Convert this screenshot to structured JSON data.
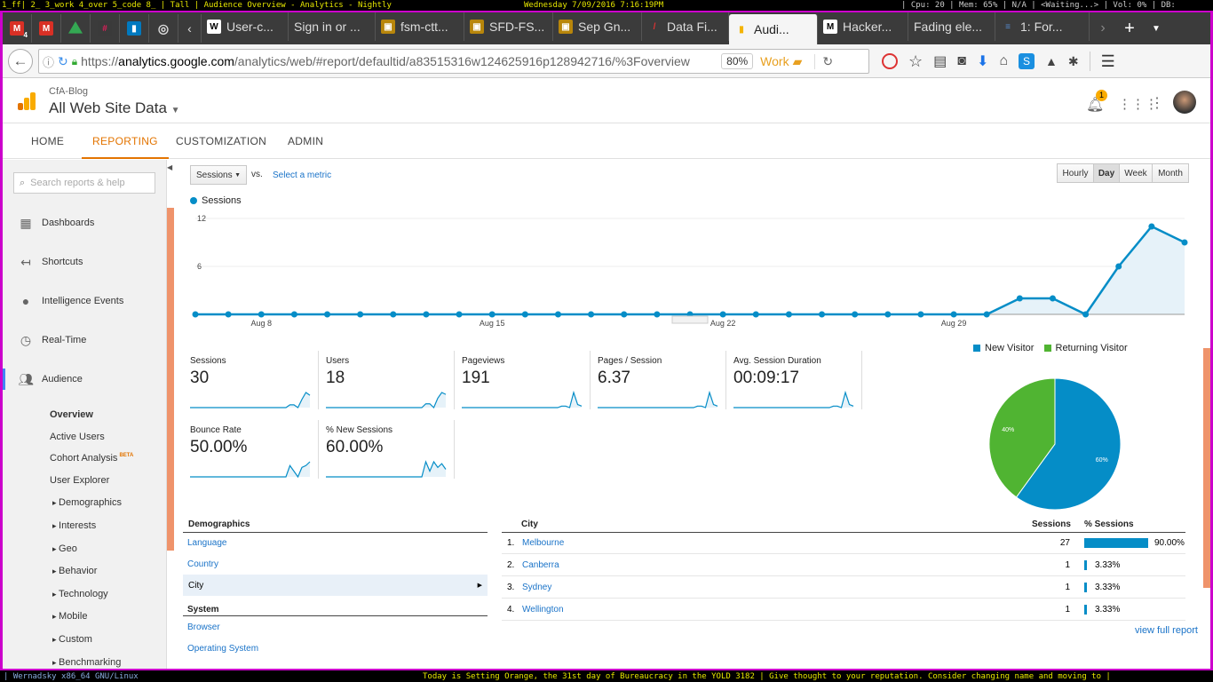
{
  "topbar": {
    "left": "1_ff| 2_ 3_work 4_over 5_code 8_ | Tall | Audience Overview - Analytics - Nightly",
    "center": "Wednesday  7/09/2016  7:16:19PM",
    "right": "| Cpu: 20 | Mem: 65% | N/A | <Waiting...> | Vol: 0% | DB:"
  },
  "bottombar": {
    "left": "| Wernadsky x86_64 GNU/Linux",
    "right": "Today is Setting Orange, the 31st day of Bureaucracy in the YOLD 3182  | Give thought to your reputation.  Consider changing name and moving to |"
  },
  "browser": {
    "tabs": [
      {
        "label": "User-c...",
        "icon": "W",
        "color": "#fff"
      },
      {
        "label": "Sign in or ...",
        "icon": "",
        "color": ""
      },
      {
        "label": "fsm-ctt...",
        "icon": "gh",
        "color": "#b8860b"
      },
      {
        "label": "SFD-FS...",
        "icon": "gh",
        "color": "#b8860b"
      },
      {
        "label": "Sep Gn...",
        "icon": "gh",
        "color": "#b8860b"
      },
      {
        "label": "Data Fi...",
        "icon": "pen",
        "color": "#d33"
      },
      {
        "label": "Audi...",
        "icon": "ga",
        "color": "#f4b400"
      },
      {
        "label": "Hacker...",
        "icon": "M",
        "color": "#fff"
      },
      {
        "label": "Fading ele...",
        "icon": "",
        "color": ""
      },
      {
        "label": "1: For...",
        "icon": "st",
        "color": "#5588cc"
      }
    ],
    "pinned_badge": "4",
    "url_prefix": "https://",
    "url_host": "analytics.google.com",
    "url_path": "/analytics/web/#report/defaultid/a83515316w124625916p128942716/%3Foverview",
    "zoom": "80%",
    "container": "Work"
  },
  "ga": {
    "property": "CfA-Blog",
    "view": "All Web Site Data",
    "notification_count": "1",
    "nav": [
      "HOME",
      "REPORTING",
      "CUSTOMIZATION",
      "ADMIN"
    ],
    "search_placeholder": "Search reports & help",
    "sidebar": {
      "main": [
        "Dashboards",
        "Shortcuts",
        "Intelligence Events",
        "Real-Time",
        "Audience"
      ],
      "sub": [
        "Overview",
        "Active Users",
        "Cohort Analysis",
        "User Explorer",
        "Demographics",
        "Interests",
        "Geo",
        "Behavior",
        "Technology",
        "Mobile",
        "Custom",
        "Benchmarking"
      ],
      "beta": "BETA"
    },
    "controls": {
      "metric": "Sessions",
      "vs": "vs.",
      "select_metric": "Select a metric",
      "granularity": [
        "Hourly",
        "Day",
        "Week",
        "Month"
      ]
    },
    "metrics": [
      {
        "label": "Sessions",
        "value": "30"
      },
      {
        "label": "Users",
        "value": "18"
      },
      {
        "label": "Pageviews",
        "value": "191"
      },
      {
        "label": "Pages / Session",
        "value": "6.37"
      },
      {
        "label": "Avg. Session Duration",
        "value": "00:09:17"
      },
      {
        "label": "Bounce Rate",
        "value": "50.00%"
      },
      {
        "label": "% New Sessions",
        "value": "60.00%"
      }
    ],
    "demographics": {
      "title": "Demographics",
      "items": [
        "Language",
        "Country",
        "City"
      ],
      "system_title": "System",
      "system_items": [
        "Browser",
        "Operating System"
      ]
    },
    "city_table": {
      "headers": [
        "City",
        "Sessions",
        "% Sessions"
      ],
      "rows": [
        {
          "rank": "1.",
          "city": "Melbourne",
          "sessions": "27",
          "pct": "90.00%",
          "frac": 0.9
        },
        {
          "rank": "2.",
          "city": "Canberra",
          "sessions": "1",
          "pct": "3.33%",
          "frac": 0.0333
        },
        {
          "rank": "3.",
          "city": "Sydney",
          "sessions": "1",
          "pct": "3.33%",
          "frac": 0.0333
        },
        {
          "rank": "4.",
          "city": "Wellington",
          "sessions": "1",
          "pct": "3.33%",
          "frac": 0.0333
        }
      ],
      "full_report": "view full report"
    }
  },
  "chart_data": [
    {
      "type": "area",
      "series": [
        {
          "name": "Sessions",
          "values": [
            0,
            0,
            0,
            0,
            0,
            0,
            0,
            0,
            0,
            0,
            0,
            0,
            0,
            0,
            0,
            0,
            0,
            0,
            0,
            0,
            0,
            0,
            0,
            0,
            0,
            2,
            2,
            0,
            6,
            11,
            9
          ]
        }
      ],
      "categories": [
        "Aug 6",
        "Aug 7",
        "Aug 8",
        "Aug 9",
        "Aug 10",
        "Aug 11",
        "Aug 12",
        "Aug 13",
        "Aug 14",
        "Aug 15",
        "Aug 16",
        "Aug 17",
        "Aug 18",
        "Aug 19",
        "Aug 20",
        "Aug 21",
        "Aug 22",
        "Aug 23",
        "Aug 24",
        "Aug 25",
        "Aug 26",
        "Aug 27",
        "Aug 28",
        "Aug 29",
        "Aug 30",
        "Aug 31",
        "Sep 1",
        "Sep 2",
        "Sep 3",
        "Sep 4",
        "Sep 5"
      ],
      "xticks": [
        "Aug 8",
        "Aug 15",
        "Aug 22",
        "Aug 29"
      ],
      "yticks": [
        "12",
        "6"
      ],
      "ylim": [
        0,
        12
      ],
      "color": "#058dc7"
    },
    {
      "type": "pie",
      "series": [
        {
          "name": "New Visitor",
          "value": 60,
          "label": "60%",
          "color": "#058dc7"
        },
        {
          "name": "Returning Visitor",
          "value": 40,
          "label": "40%",
          "color": "#50b432"
        }
      ]
    }
  ]
}
